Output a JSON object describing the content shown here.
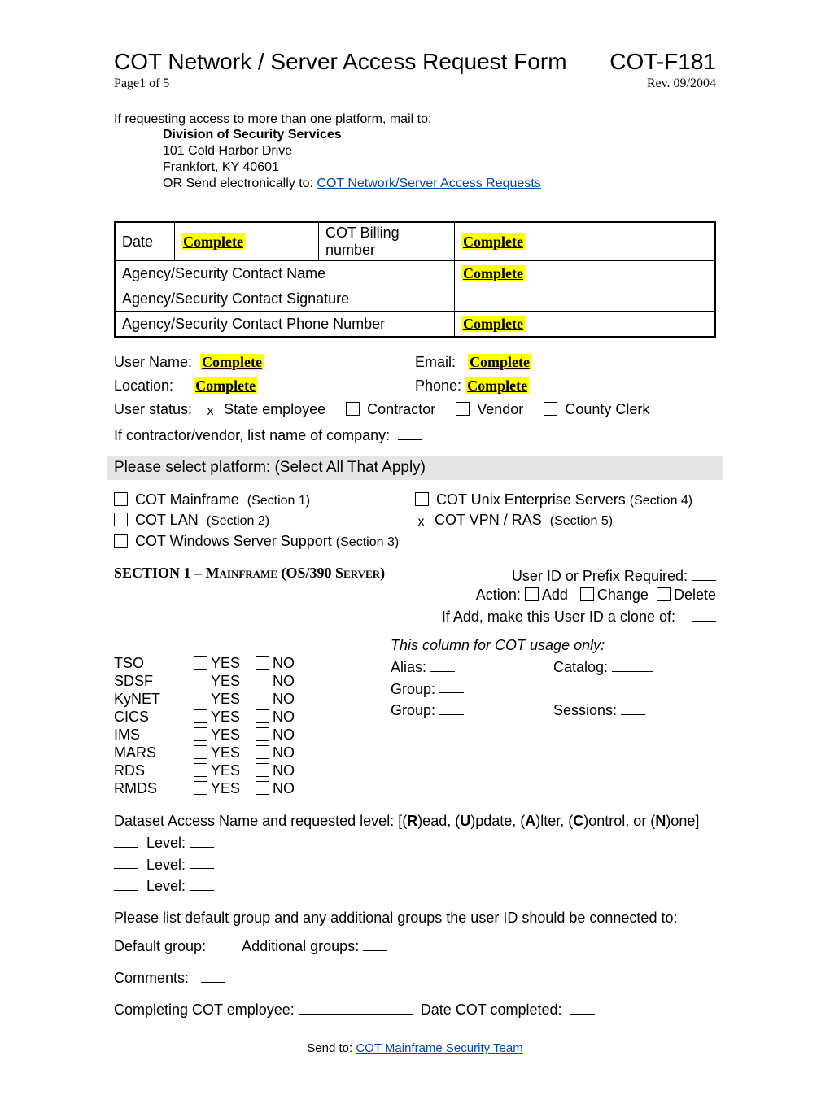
{
  "header": {
    "title": "COT Network / Server Access Request Form",
    "code": "COT-F181",
    "page": "Page1 of 5",
    "rev": "Rev. 09/2004"
  },
  "intro": {
    "line1": "If requesting access to more than one platform, mail to:",
    "division": "Division of Security Services",
    "addr1": "101 Cold Harbor Drive",
    "addr2": "Frankfort, KY  40601",
    "orsend": "OR Send electronically to:  ",
    "link": "COT Network/Server Access Requests"
  },
  "formbox": {
    "date_label": "Date",
    "date_value": "Complete",
    "billing_label": "COT Billing number",
    "billing_value": "Complete",
    "contact_name_label": "Agency/Security Contact Name",
    "contact_name_value": "Complete",
    "contact_sig_label": "Agency/Security Contact Signature",
    "contact_phone_label": "Agency/Security Contact Phone Number",
    "contact_phone_value": "Complete"
  },
  "user": {
    "username_label": "User Name:",
    "username_value": "Complete",
    "email_label": "Email:",
    "email_value": "Complete",
    "location_label": "Location:",
    "location_value": "Complete",
    "phone_label": "Phone:",
    "phone_value": "Complete",
    "status_label": "User status:",
    "state_emp": "State employee",
    "contractor": "Contractor",
    "vendor": "Vendor",
    "county": "County Clerk",
    "company_label": "If contractor/vendor, list name of company:"
  },
  "platform": {
    "header": "Please select platform:  (Select All That Apply)",
    "mainframe": "COT Mainframe",
    "mainframe_note": "(Section 1)",
    "unix": "COT Unix Enterprise Servers",
    "unix_note": "(Section 4)",
    "lan": "COT LAN",
    "lan_note": "(Section 2)",
    "vpn": "COT VPN / RAS",
    "vpn_note": "(Section 5)",
    "win": "COT Windows Server Support",
    "win_note": "(Section 3)"
  },
  "section1": {
    "title_a": "SECTION 1 – M",
    "title_b": "ainframe",
    "title_c": " (OS/390 S",
    "title_d": "erver",
    "title_e": ")",
    "userid_label": "User ID or Prefix Required:",
    "action_label": "Action:",
    "add": "Add",
    "change": "Change",
    "delete": "Delete",
    "clone_label": "If Add, make this User ID a clone of:",
    "cot_only": "This column for COT usage only:",
    "alias": "Alias:",
    "catalog": "Catalog:",
    "group": "Group:",
    "sessions": "Sessions:",
    "items": [
      "TSO",
      "SDSF",
      "KyNET",
      "CICS",
      "IMS",
      "MARS",
      "RDS",
      "RMDS"
    ],
    "yes": "YES",
    "no": "NO",
    "dataset": "Dataset Access Name and requested level:  [(",
    "R": "R",
    "r": ")ead, (",
    "U": "U",
    "u": ")pdate, (",
    "A": "A",
    "a": ")lter, (",
    "C": "C",
    "c": ")ontrol, or (",
    "N": "N",
    "n": ")one]",
    "level": "Level:",
    "listgroups": "Please list default group and any additional groups the user ID should be connected to:",
    "defgroup": "Default group:",
    "addgroups": "Additional groups:",
    "comments": "Comments:",
    "completing": "Completing COT employee:",
    "datecomp": "Date COT completed:"
  },
  "footer": {
    "sendto": "Send to: ",
    "link": "COT Mainframe Security Team"
  }
}
